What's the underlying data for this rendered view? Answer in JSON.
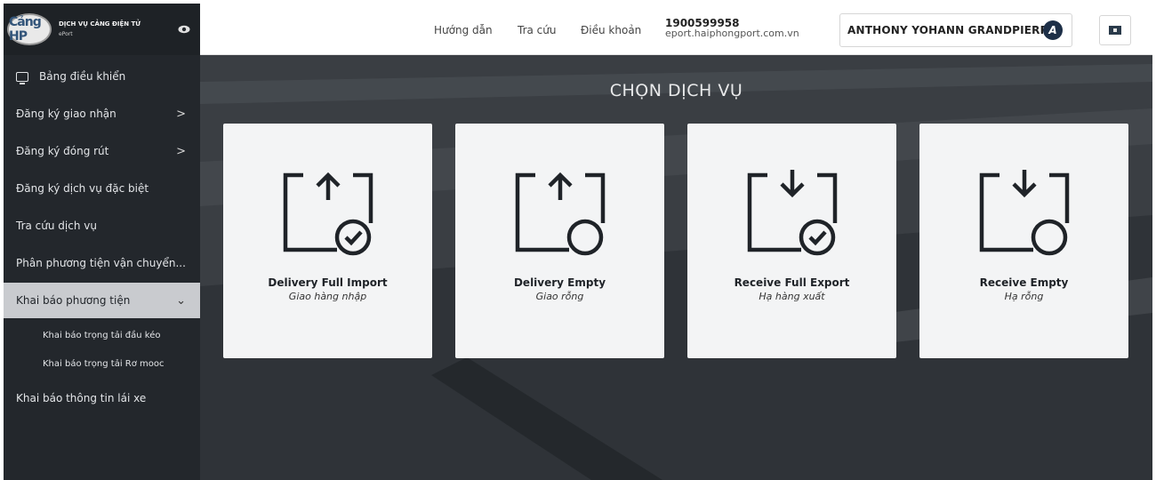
{
  "brand": {
    "logo_text": "Cảng HP",
    "title": "DỊCH VỤ CẢNG ĐIỆN TỬ",
    "subtitle": "ePort"
  },
  "sidebar": {
    "items": [
      {
        "label": "Bảng điều khiển",
        "has_icon": true
      },
      {
        "label": "Đăng ký giao nhận",
        "chevron": ">"
      },
      {
        "label": "Đăng ký đóng rút",
        "chevron": ">"
      },
      {
        "label": "Đăng ký dịch vụ đặc biệt"
      },
      {
        "label": "Tra cứu dịch vụ"
      },
      {
        "label": "Phân phương tiện vận chuyển..."
      },
      {
        "label": "Khai báo phương tiện",
        "chevron": "⌄",
        "active": true
      },
      {
        "label": "Khai báo thông tin lái xe"
      }
    ],
    "sub_items": [
      {
        "label": "Khai báo trọng tải đầu kéo"
      },
      {
        "label": "Khai báo trọng tải Rơ mooc"
      }
    ]
  },
  "header": {
    "links": [
      "Hướng dẫn",
      "Tra cứu",
      "Điều khoản"
    ],
    "phone": "1900599958",
    "website": "eport.haiphongport.com.vn",
    "user_name": "ANTHONY YOHANN GRANDPIERRE",
    "avatar_letter": "A"
  },
  "main": {
    "title": "CHỌN DỊCH VỤ",
    "cards": [
      {
        "title": "Delivery Full Import",
        "subtitle": "Giao hàng nhập",
        "icon": "box-arrow-up-check-icon"
      },
      {
        "title": "Delivery Empty",
        "subtitle": "Giao rỗng",
        "icon": "box-arrow-up-circle-icon"
      },
      {
        "title": "Receive Full Export",
        "subtitle": "Hạ hàng xuất",
        "icon": "box-arrow-down-check-icon"
      },
      {
        "title": "Receive Empty",
        "subtitle": "Hạ rỗng",
        "icon": "box-arrow-down-circle-icon"
      }
    ]
  },
  "colors": {
    "sidebar_bg": "#23272c",
    "active_item_bg": "#c9cbcf",
    "card_bg": "#f3f4f5",
    "avatar_bg": "#1d2f47"
  }
}
